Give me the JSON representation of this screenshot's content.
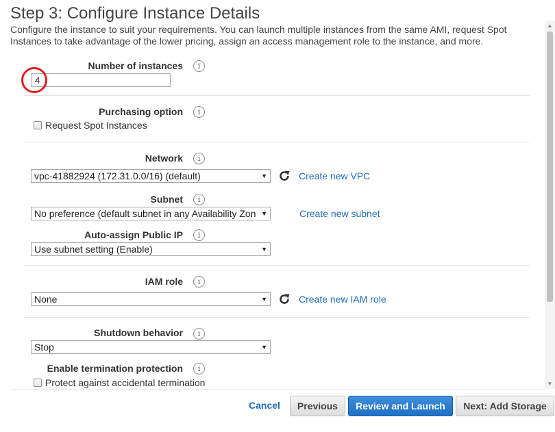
{
  "header": {
    "title": "Step 3: Configure Instance Details",
    "description": "Configure the instance to suit your requirements. You can launch multiple instances from the same AMI, request Spot Instances to take advantage of the lower pricing, assign an access management role to the instance, and more."
  },
  "info_glyph": "i",
  "fields": {
    "number_of_instances": {
      "label": "Number of instances",
      "value": "4"
    },
    "purchasing_option": {
      "label": "Purchasing option",
      "checkbox_label": "Request Spot Instances"
    },
    "network": {
      "label": "Network",
      "value": "vpc-41882924 (172.31.0.0/16) (default)",
      "link": "Create new VPC"
    },
    "subnet": {
      "label": "Subnet",
      "value": "No preference (default subnet in any Availability Zon",
      "link": "Create new subnet"
    },
    "auto_assign_public_ip": {
      "label": "Auto-assign Public IP",
      "value": "Use subnet setting (Enable)"
    },
    "iam_role": {
      "label": "IAM role",
      "value": "None",
      "link": "Create new IAM role"
    },
    "shutdown_behavior": {
      "label": "Shutdown behavior",
      "value": "Stop"
    },
    "termination_protection": {
      "label": "Enable termination protection",
      "checkbox_label": "Protect against accidental termination"
    }
  },
  "footer": {
    "cancel": "Cancel",
    "previous": "Previous",
    "review_launch": "Review and Launch",
    "next": "Next: Add Storage"
  },
  "colors": {
    "link": "#1e6fb5",
    "primary_button": "#2b7bd0",
    "highlight_circle": "#e01c1c"
  },
  "icons": [
    "info-icon",
    "refresh-icon",
    "dropdown-caret-icon",
    "scroll-up-icon",
    "scroll-down-icon"
  ]
}
